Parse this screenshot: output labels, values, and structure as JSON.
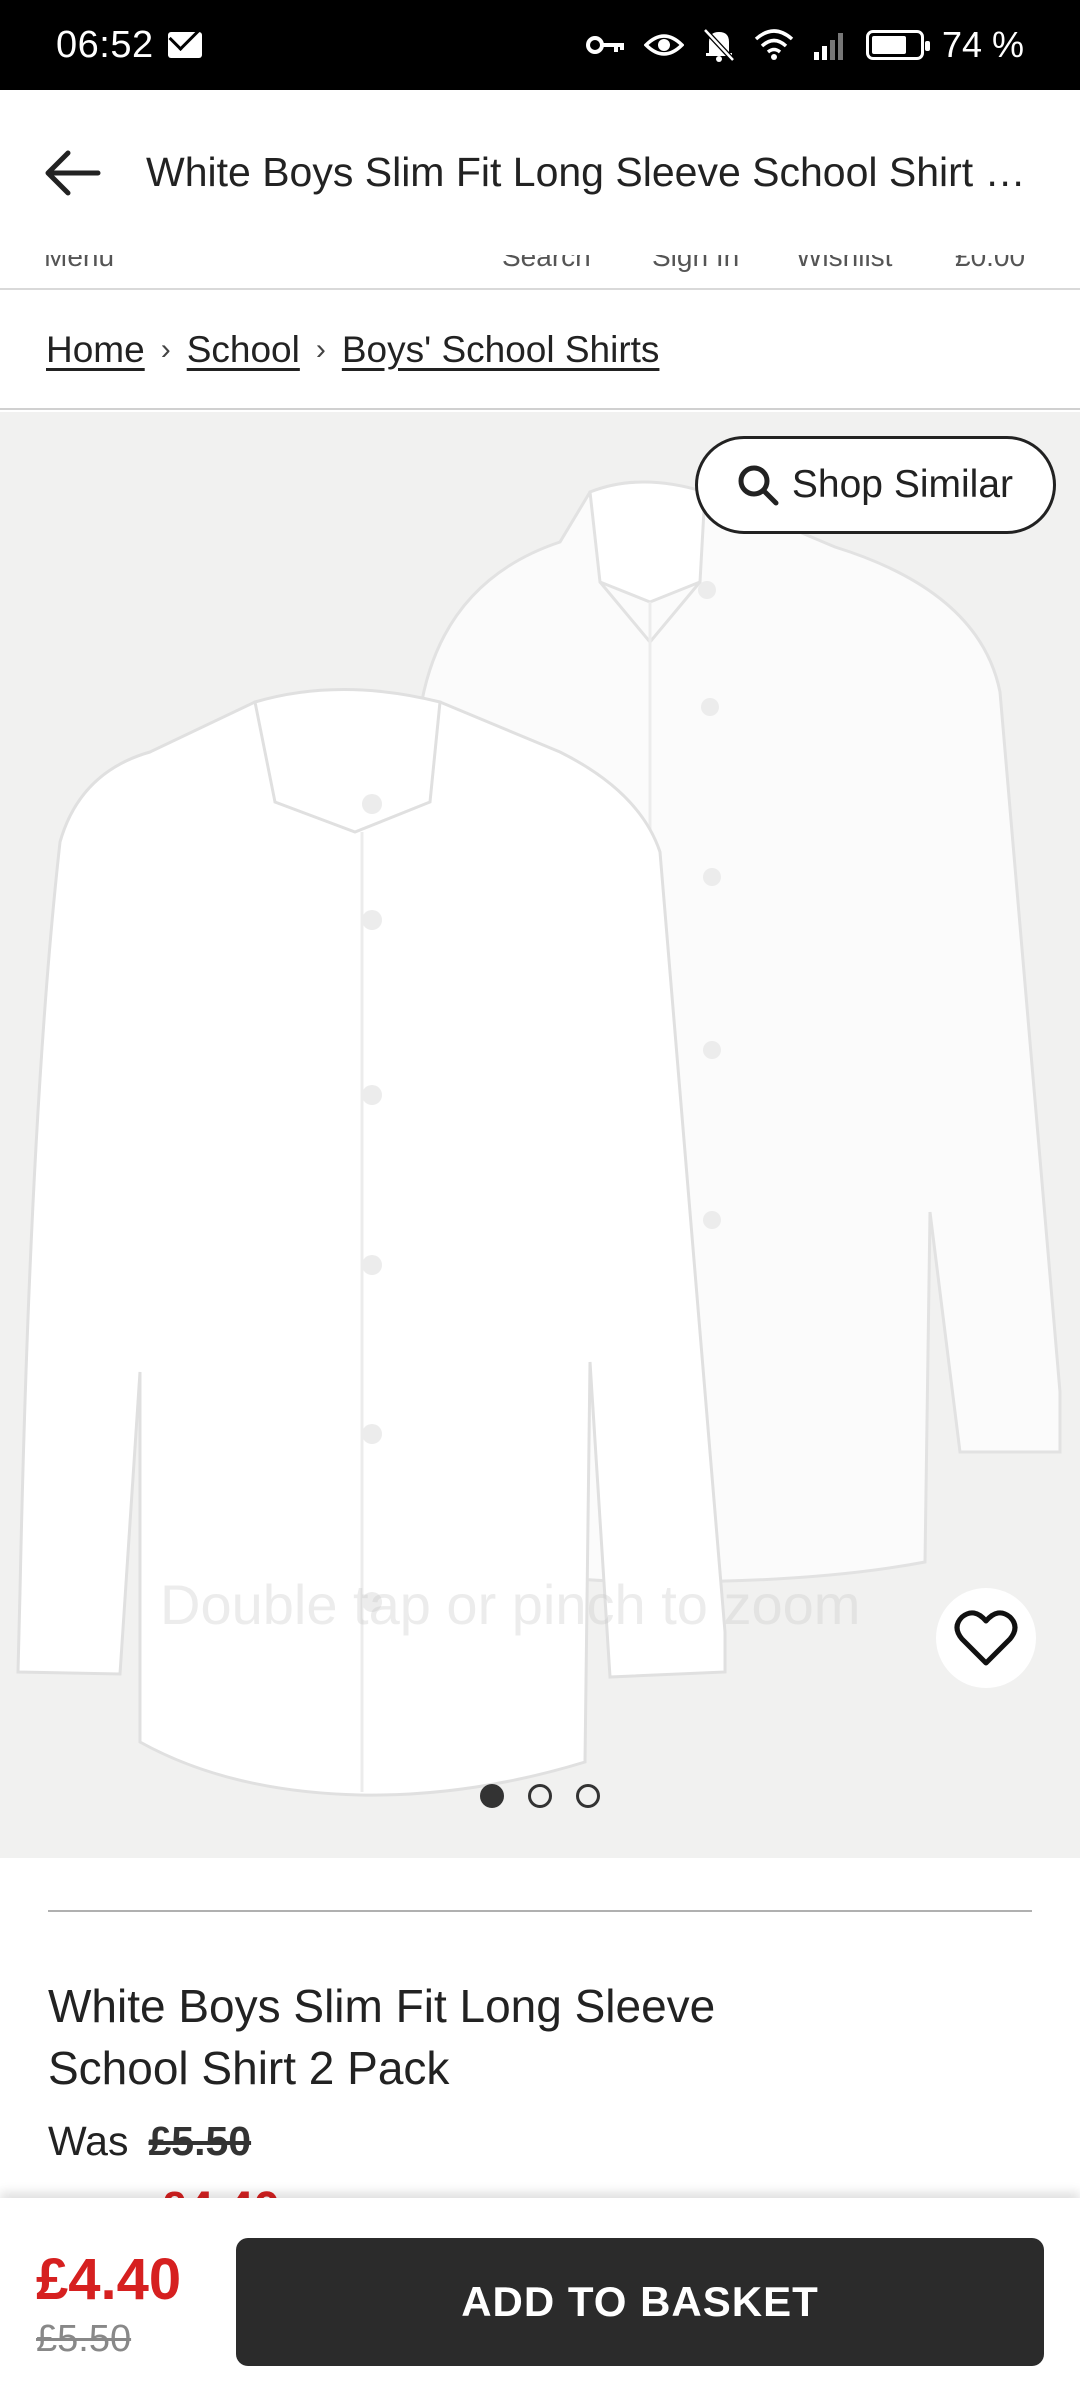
{
  "status_bar": {
    "time": "06:52",
    "battery": "74 %",
    "battery_level": 0.74,
    "icons": [
      "mail-icon",
      "key-icon",
      "eye-icon",
      "bell-off-icon",
      "wifi-icon",
      "signal-icon",
      "battery-icon"
    ]
  },
  "app_bar": {
    "title": "White Boys Slim Fit Long Sleeve School Shirt 2 Pack",
    "back_icon": "arrow-left-icon"
  },
  "nav_strip": {
    "items": [
      "Menu",
      "Search",
      "Sign In",
      "Wishlist",
      "£0.00"
    ]
  },
  "breadcrumb": {
    "items": [
      "Home",
      "School",
      "Boys' School Shirts"
    ]
  },
  "gallery": {
    "shop_similar_label": "Shop Similar",
    "watermark": "Double tap or pinch to zoom",
    "image_count": 3,
    "active_index": 0,
    "wishlist_icon": "heart-icon"
  },
  "product": {
    "title": "White Boys Slim Fit Long Sleeve School Shirt 2 Pack",
    "was_label": "Was",
    "was_price": "£5.50",
    "now_price": "£4.40"
  },
  "sticky_bar": {
    "price": "£4.40",
    "old_price": "£5.50",
    "add_to_basket_label": "ADD TO BASKET"
  },
  "colors": {
    "sale_red": "#d62020",
    "button_dark": "#2b2b2b",
    "gallery_bg": "#f1f1f0"
  }
}
